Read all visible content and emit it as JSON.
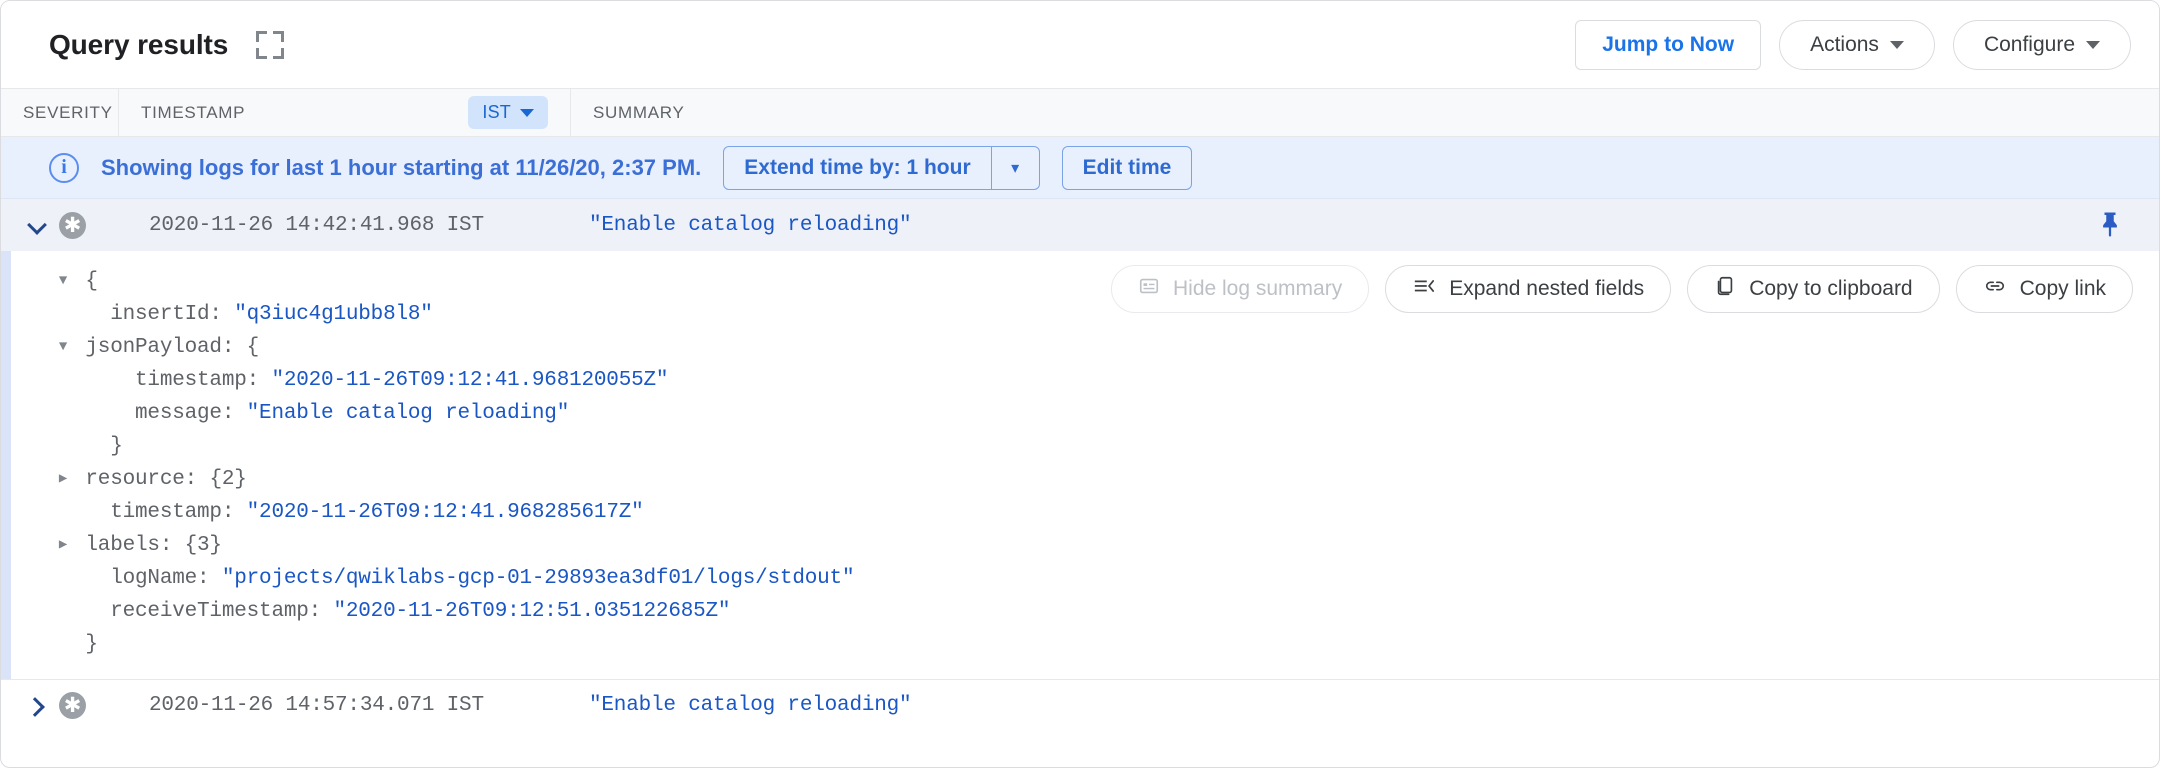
{
  "header": {
    "title": "Query results",
    "expand_icon": "fullscreen-expand-icon",
    "jump_to_now": "Jump to Now",
    "actions": "Actions",
    "configure": "Configure"
  },
  "columns": {
    "severity": "SEVERITY",
    "timestamp": "TIMESTAMP",
    "timezone": "IST",
    "summary": "SUMMARY"
  },
  "banner": {
    "icon": "info-icon",
    "message": "Showing logs for last 1 hour starting at 11/26/20, 2:37 PM.",
    "extend_label": "Extend time by: 1 hour",
    "extend_caret": "chevron-down-icon",
    "edit_time": "Edit time"
  },
  "detail_actions": [
    {
      "label": "Hide log summary",
      "icon": "log-summary-icon",
      "disabled": true
    },
    {
      "label": "Expand nested fields",
      "icon": "expand-nested-icon",
      "disabled": false
    },
    {
      "label": "Copy to clipboard",
      "icon": "copy-icon",
      "disabled": false
    },
    {
      "label": "Copy link",
      "icon": "link-icon",
      "disabled": false
    }
  ],
  "rows": [
    {
      "expanded": true,
      "severity_icon": "default-severity-icon",
      "timestamp": "2020-11-26 14:42:41.968 IST",
      "summary": "\"Enable catalog reloading\"",
      "pin_icon": "pin-icon"
    },
    {
      "expanded": false,
      "severity_icon": "default-severity-icon",
      "timestamp": "2020-11-26 14:57:34.071 IST",
      "summary": "\"Enable catalog reloading\""
    }
  ],
  "json_tree": [
    {
      "marker": "down",
      "indent": 0,
      "key": "",
      "punc": "{",
      "value": ""
    },
    {
      "marker": "none",
      "indent": 1,
      "key": "insertId: ",
      "punc": "",
      "value": "\"q3iuc4g1ubb8l8\""
    },
    {
      "marker": "down",
      "indent": 0,
      "key": "jsonPayload: ",
      "punc": "{",
      "value": ""
    },
    {
      "marker": "none",
      "indent": 2,
      "key": "timestamp: ",
      "punc": "",
      "value": "\"2020-11-26T09:12:41.968120055Z\""
    },
    {
      "marker": "none",
      "indent": 2,
      "key": "message: ",
      "punc": "",
      "value": "\"Enable catalog reloading\""
    },
    {
      "marker": "none",
      "indent": 1,
      "key": "",
      "punc": "}",
      "value": ""
    },
    {
      "marker": "right",
      "indent": 0,
      "key": "resource: ",
      "punc": "{2}",
      "value": ""
    },
    {
      "marker": "none",
      "indent": 1,
      "key": "timestamp: ",
      "punc": "",
      "value": "\"2020-11-26T09:12:41.968285617Z\""
    },
    {
      "marker": "right",
      "indent": 0,
      "key": "labels: ",
      "punc": "{3}",
      "value": ""
    },
    {
      "marker": "none",
      "indent": 1,
      "key": "logName: ",
      "punc": "",
      "value": "\"projects/qwiklabs-gcp-01-29893ea3df01/logs/stdout\""
    },
    {
      "marker": "none",
      "indent": 1,
      "key": "receiveTimestamp: ",
      "punc": "",
      "value": "\"2020-11-26T09:12:51.035122685Z\""
    },
    {
      "marker": "none",
      "indent": 0,
      "key": "",
      "punc": "}",
      "value": ""
    }
  ],
  "colors": {
    "accent_blue": "#1a73e8",
    "banner_bg": "#e8f0fe",
    "json_value_blue": "#1a56c4",
    "severity_gray": "#9aa0a6",
    "row_expanded_bg": "#eef1f8"
  }
}
